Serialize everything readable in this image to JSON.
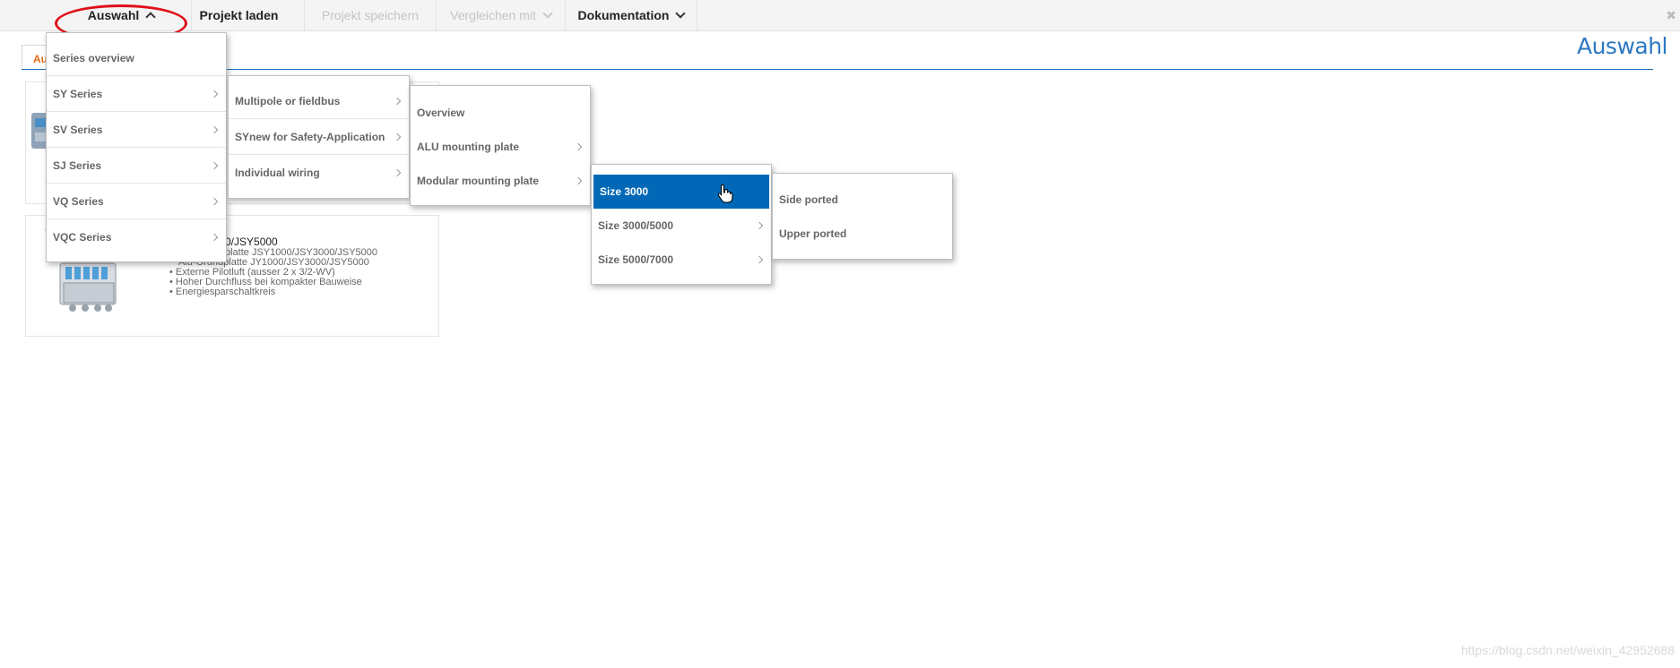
{
  "menubar": {
    "items": [
      {
        "label": "Auswahl",
        "state": "open"
      },
      {
        "label": "Projekt laden",
        "state": "enabled"
      },
      {
        "label": "Projekt speichern",
        "state": "disabled"
      },
      {
        "label": "Vergleichen mit",
        "state": "disabled"
      },
      {
        "label": "Dokumentation",
        "state": "enabled"
      }
    ],
    "close_glyph": "✖"
  },
  "page": {
    "tab_label": "Auswahl",
    "title": "Auswahl",
    "card2": {
      "title_visible": "0/JSY5000",
      "bullets": [
        "platte JSY1000/JSY3000/JSY5000",
        "Alu-Grundplatte JY1000/JSY3000/JSY5000",
        "Externe Pilotluft (ausser 2 x 3/2-WV)",
        "Hoher Durchfluss bei kompakter Bauweise",
        "Energiesparschaltkreis"
      ]
    }
  },
  "menus": {
    "level1": {
      "items": [
        {
          "label": "Series overview",
          "has_submenu": false
        },
        {
          "label": "SY Series",
          "has_submenu": true
        },
        {
          "label": "SV Series",
          "has_submenu": true
        },
        {
          "label": "SJ Series",
          "has_submenu": true
        },
        {
          "label": "VQ Series",
          "has_submenu": true
        },
        {
          "label": "VQC Series",
          "has_submenu": true
        }
      ]
    },
    "level2": {
      "items": [
        {
          "label": "Multipole or fieldbus",
          "has_submenu": true
        },
        {
          "label": "SYnew for Safety-Application",
          "has_submenu": true
        },
        {
          "label": "Individual wiring",
          "has_submenu": true
        }
      ]
    },
    "level3": {
      "items": [
        {
          "label": "Overview",
          "has_submenu": false
        },
        {
          "label": "ALU mounting plate",
          "has_submenu": true
        },
        {
          "label": "Modular mounting plate",
          "has_submenu": true
        }
      ]
    },
    "level4": {
      "items": [
        {
          "label": "Size 3000",
          "has_submenu": true,
          "active": true
        },
        {
          "label": "Size 3000/5000",
          "has_submenu": true
        },
        {
          "label": "Size 5000/7000",
          "has_submenu": true
        }
      ]
    },
    "level5": {
      "items": [
        {
          "label": "Side ported",
          "has_submenu": false
        },
        {
          "label": "Upper ported",
          "has_submenu": false
        }
      ]
    }
  },
  "colors": {
    "accent": "#0068b7",
    "highlight_ring": "#e0101a",
    "tab_text": "#e36b14",
    "title": "#2b78c2"
  },
  "watermark": "https://blog.csdn.net/weixin_42952688"
}
